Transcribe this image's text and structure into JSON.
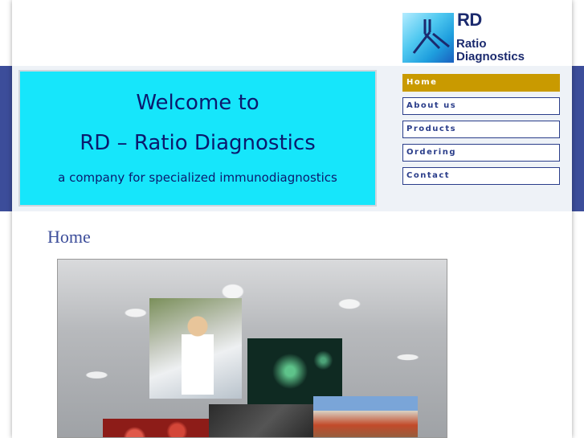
{
  "logo": {
    "line1": "RD",
    "line2": "Ratio",
    "line3": "Diagnostics"
  },
  "banner": {
    "line1": "Welcome to",
    "line2": "RD – Ratio Diagnostics",
    "line3": "a company for specialized immunodiagnostics"
  },
  "nav": {
    "items": [
      {
        "label": "Home",
        "active": true
      },
      {
        "label": "About us",
        "active": false
      },
      {
        "label": "Products",
        "active": false
      },
      {
        "label": "Ordering",
        "active": false
      },
      {
        "label": "Contact",
        "active": false
      }
    ]
  },
  "main": {
    "heading": "Home"
  },
  "colors": {
    "band": "#3c4d9a",
    "banner_bg": "#16e6fb",
    "nav_active": "#c99a00",
    "text_dark_blue": "#0b1a6e"
  }
}
